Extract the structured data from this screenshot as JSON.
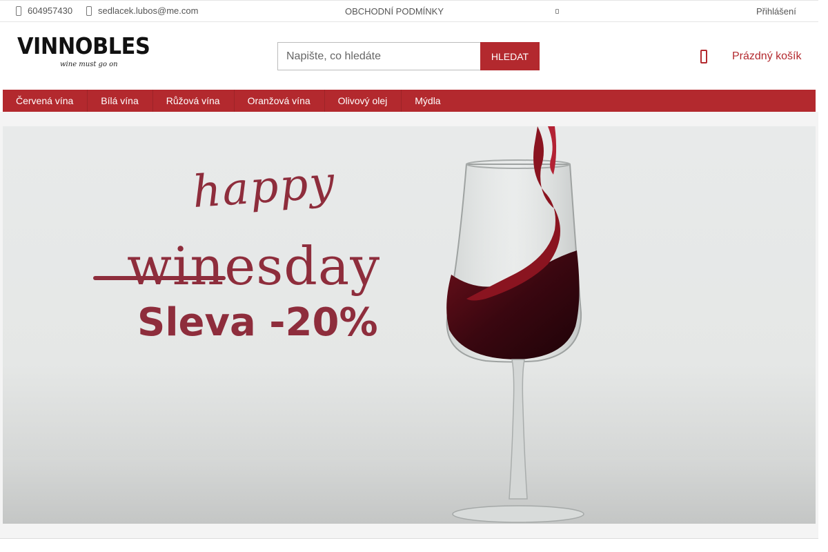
{
  "topbar": {
    "phone": "604957430",
    "email": "sedlacek.lubos@me.com",
    "terms": "OBCHODNÍ PODMÍNKY",
    "login": "Přihlášení"
  },
  "header": {
    "logo_name": "VINNOBLES",
    "logo_tagline": "wine must go on",
    "search_placeholder": "Napište, co hledáte",
    "search_button": "HLEDAT",
    "cart_label": "Prázdný košík"
  },
  "nav": {
    "items": [
      {
        "label": "Červená vína"
      },
      {
        "label": "Bílá vína"
      },
      {
        "label": "Růžová vína"
      },
      {
        "label": "Oranžová vína"
      },
      {
        "label": "Olivový olej"
      },
      {
        "label": "Mýdla"
      }
    ]
  },
  "banner": {
    "line1": "happy",
    "line2": "winesday",
    "line3": "Sleva -20%"
  },
  "colors": {
    "brand": "#b3292e",
    "banner_text": "#8e2d3c"
  },
  "icons": [
    "phone-icon",
    "email-icon",
    "cart-icon"
  ]
}
